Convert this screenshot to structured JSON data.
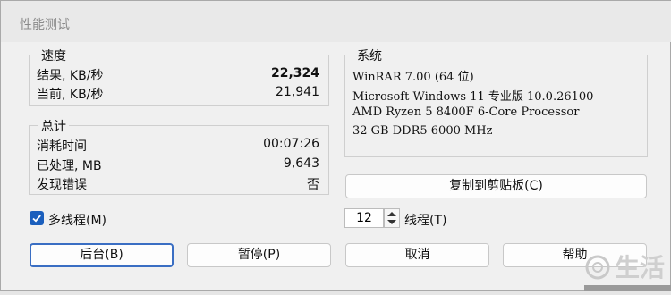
{
  "window": {
    "title": "性能测试"
  },
  "speed": {
    "title": "速度",
    "result_label": "结果, KB/秒",
    "result_value": "22,324",
    "current_label": "当前, KB/秒",
    "current_value": "21,941"
  },
  "totals": {
    "title": "总计",
    "elapsed_label": "消耗时间",
    "elapsed_value": "00:07:26",
    "processed_label": "已处理, MB",
    "processed_value": "9,643",
    "errors_label": "发现错误",
    "errors_value": "否"
  },
  "system": {
    "title": "系统",
    "lines": [
      "WinRAR 7.00 (64 位)",
      "Microsoft Windows 11 专业版 10.0.26100",
      "AMD Ryzen 5 8400F 6-Core Processor",
      "32 GB DDR5 6000 MHz"
    ]
  },
  "copy_button": "复制到剪贴板(C)",
  "multithread": {
    "label": "多线程(M)",
    "checked": true
  },
  "threads": {
    "value": "12",
    "label": "线程(T)"
  },
  "buttons": {
    "background": "后台(B)",
    "pause": "暂停(P)",
    "cancel": "取消",
    "help": "帮助"
  },
  "watermark_text": "生活",
  "colors": {
    "accent": "#1b5fbd",
    "default_button_border": "#3a6ec3"
  }
}
